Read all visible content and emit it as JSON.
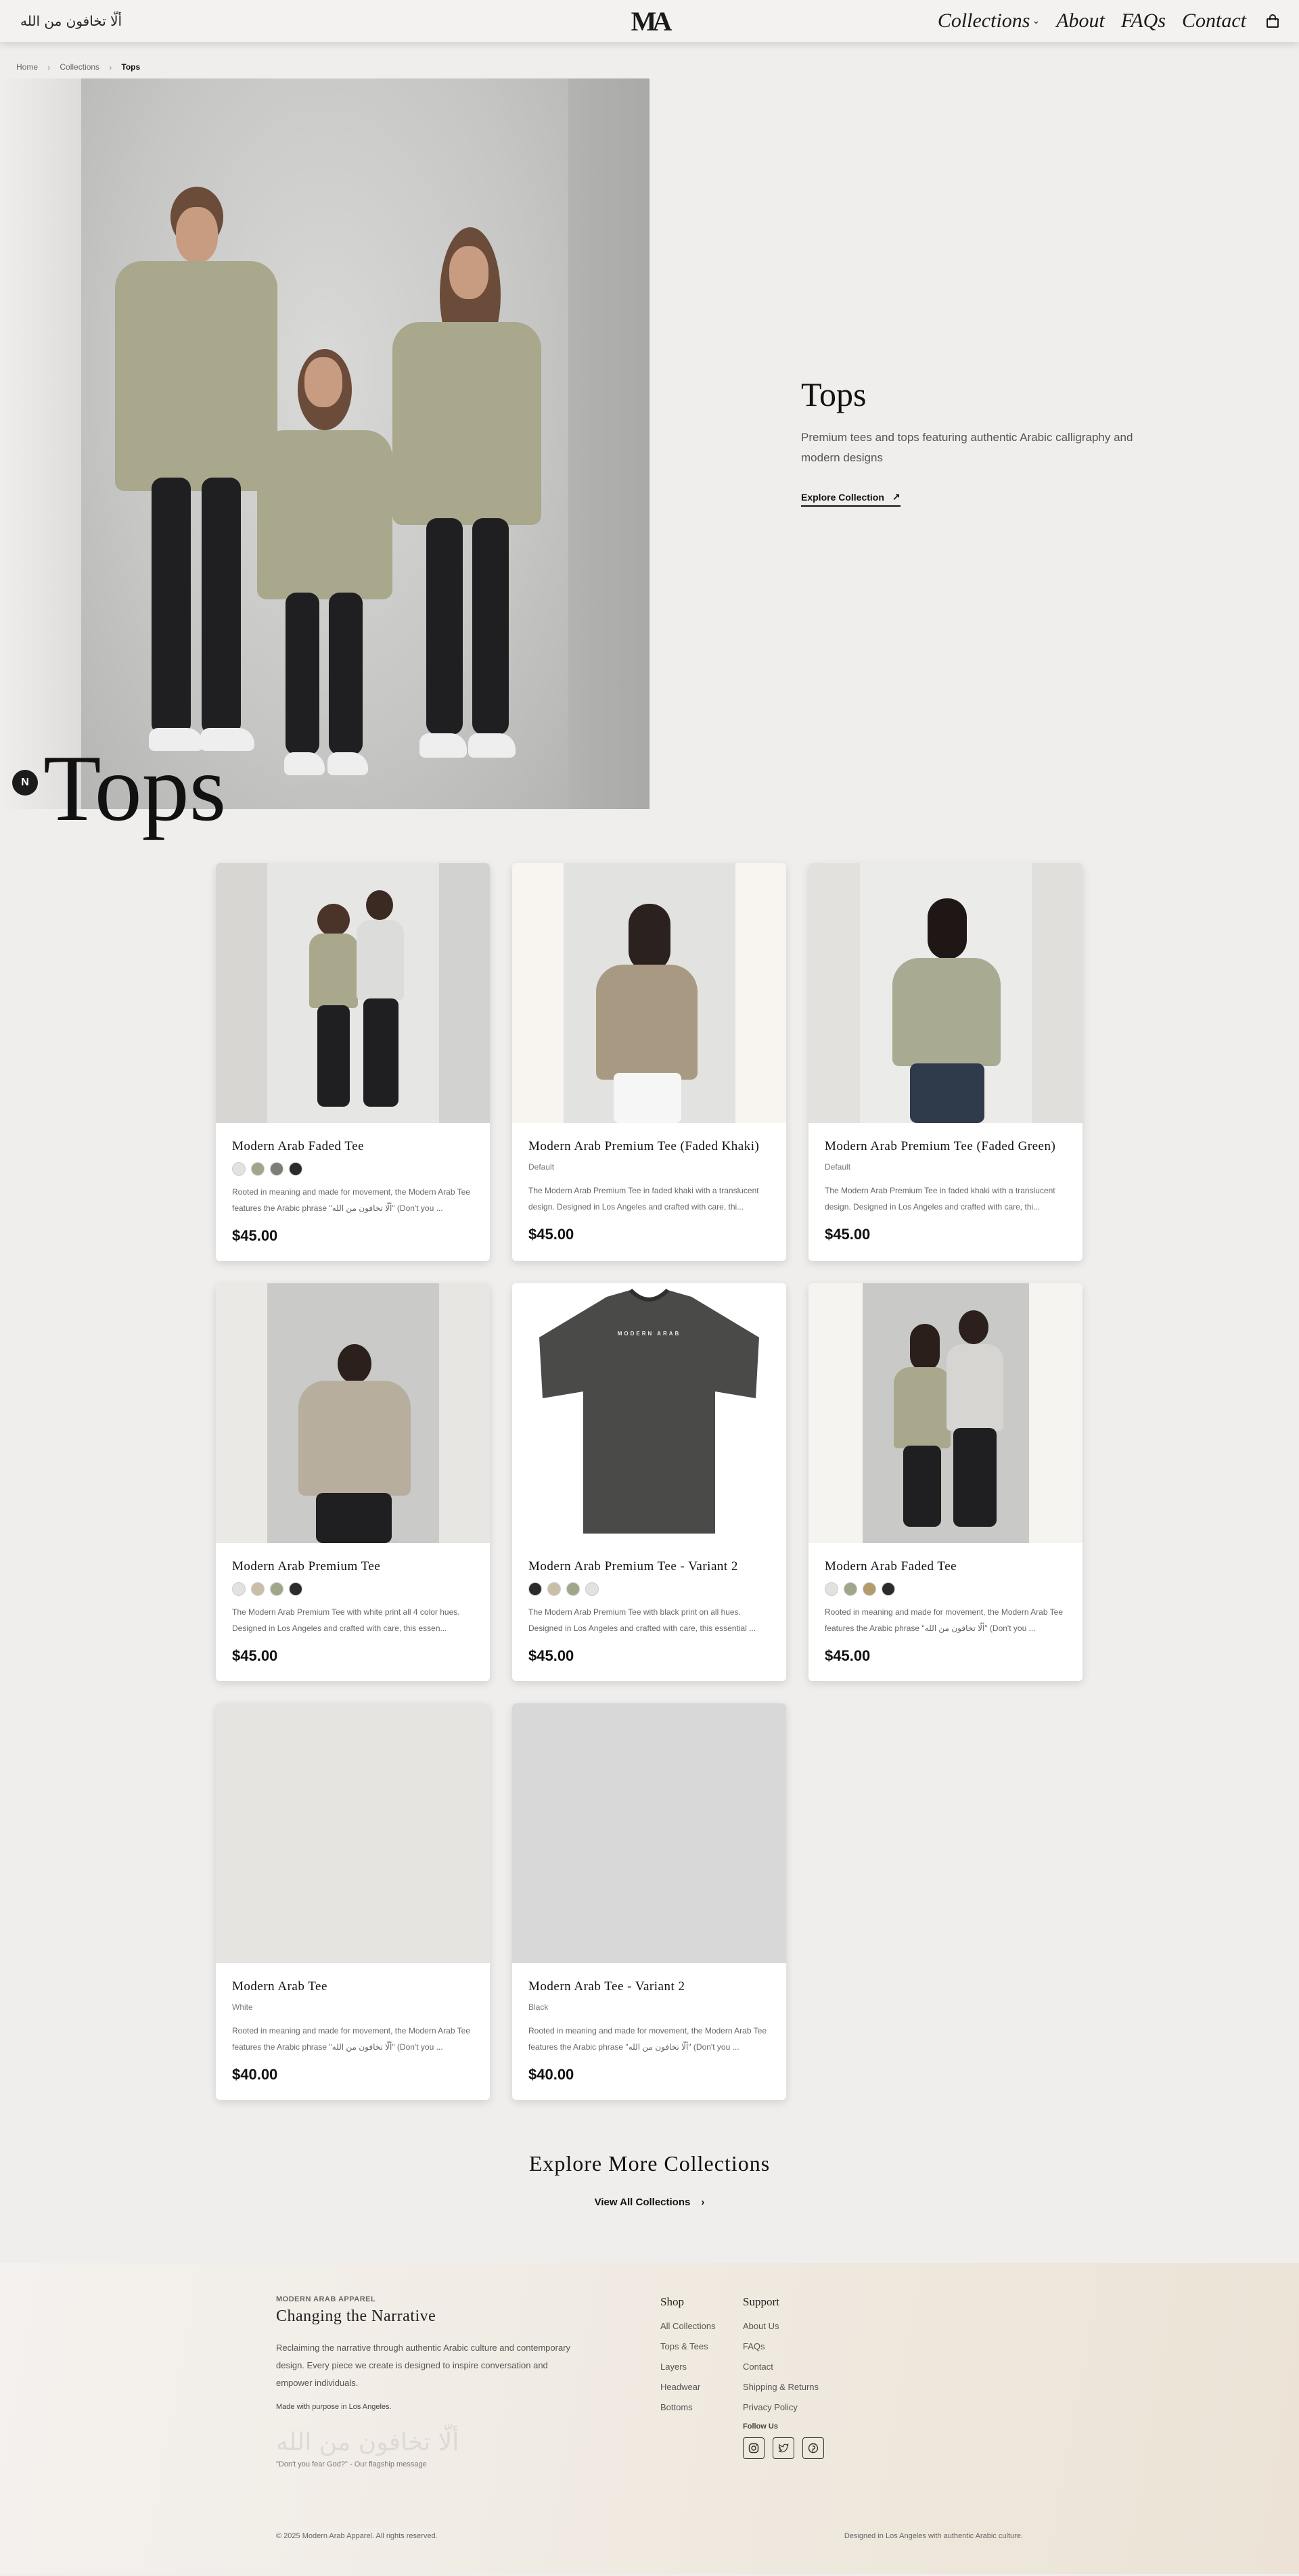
{
  "header": {
    "arabic_logo": "ألّا تخافون من الله",
    "brand_mark": "MA",
    "nav": [
      {
        "label": "Collections",
        "has_dropdown": true
      },
      {
        "label": "About"
      },
      {
        "label": "FAQs"
      },
      {
        "label": "Contact"
      }
    ],
    "cart_icon": "shopping-bag-icon"
  },
  "breadcrumb": {
    "items": [
      "Home",
      "Collections"
    ],
    "current": "Tops"
  },
  "hero": {
    "overlay_title": "Tops",
    "badge_letter": "N",
    "title": "Tops",
    "description": "Premium tees and tops featuring authentic Arabic calligraphy and modern designs",
    "cta_label": "Explore Collection",
    "cta_icon": "arrow-up-right-icon"
  },
  "products": [
    {
      "name": "Modern Arab Faded Tee",
      "swatches": [
        "#e4e2df",
        "#9fa78b",
        "#7b7e77",
        "#2b2b2b"
      ],
      "variant": "",
      "description": "Rooted in meaning and made for movement, the Modern Arab Tee features the Arabic phrase \"ألّا تخافون من الله\" (Don't you ...",
      "price": "$45.00"
    },
    {
      "name": "Modern Arab Premium Tee (Faded Khaki)",
      "swatches": [],
      "variant": "Default",
      "description": "The Modern Arab Premium Tee in faded khaki with a translucent design. Designed in Los Angeles and crafted with care, thi...",
      "price": "$45.00"
    },
    {
      "name": "Modern Arab Premium Tee (Faded Green)",
      "swatches": [],
      "variant": "Default",
      "description": "The Modern Arab Premium Tee in faded khaki with a translucent design. Designed in Los Angeles and crafted with care, thi...",
      "price": "$45.00"
    },
    {
      "name": "Modern Arab Premium Tee",
      "swatches": [
        "#e4e2df",
        "#c9bfa6",
        "#9fa78b",
        "#2b2b2b"
      ],
      "variant": "",
      "description": "The Modern Arab Premium Tee with white print all 4 color hues. Designed in Los Angeles and crafted with care, this essen...",
      "price": "$45.00"
    },
    {
      "name": "Modern Arab Premium Tee - Variant 2",
      "swatches": [
        "#2b2b2b",
        "#c9bfa6",
        "#9fa78b",
        "#e4e2df"
      ],
      "variant": "",
      "description": "The Modern Arab Premium Tee with black print on all hues. Designed in Los Angeles and crafted with care, this essential ...",
      "price": "$45.00"
    },
    {
      "name": "Modern Arab Faded Tee",
      "swatches": [
        "#e4e2df",
        "#9fa78b",
        "#b39c6a",
        "#2b2b2b"
      ],
      "variant": "",
      "description": "Rooted in meaning and made for movement, the Modern Arab Tee features the Arabic phrase \"ألّا تخافون من الله\" (Don't you ...",
      "price": "$45.00"
    },
    {
      "name": "Modern Arab Tee",
      "swatches": [],
      "variant": "White",
      "description": "Rooted in meaning and made for movement, the Modern Arab Tee features the Arabic phrase \"ألّا تخافون من الله\" (Don't you ...",
      "price": "$40.00"
    },
    {
      "name": "Modern Arab Tee - Variant 2",
      "swatches": [],
      "variant": "Black",
      "description": "Rooted in meaning and made for movement, the Modern Arab Tee features the Arabic phrase \"ألّا تخافون من الله\" (Don't you ...",
      "price": "$40.00"
    }
  ],
  "shirt_print": "MODERN ARAB",
  "explore_more": {
    "title": "Explore More Collections",
    "link_label": "View All Collections"
  },
  "footer": {
    "brand": "MODERN ARAB APPAREL",
    "tagline": "Changing the Narrative",
    "about": "Reclaiming the narrative through authentic Arabic culture and contemporary design. Every piece we create is designed to inspire conversation and empower individuals.",
    "made_with": "Made with purpose in Los Angeles.",
    "arabic_phrase": "ألّا تخافون من الله",
    "quote": "\"Don't you fear God?\" - Our flagship message",
    "shop": {
      "title": "Shop",
      "links": [
        "All Collections",
        "Tops & Tees",
        "Layers",
        "Headwear",
        "Bottoms"
      ]
    },
    "support": {
      "title": "Support",
      "links": [
        "About Us",
        "FAQs",
        "Contact",
        "Shipping & Returns",
        "Privacy Policy"
      ]
    },
    "follow_label": "Follow Us",
    "socials": [
      "instagram-icon",
      "twitter-icon",
      "pinterest-icon"
    ],
    "copyright": "© 2025 Modern Arab Apparel. All rights reserved.",
    "designed_in": "Designed in Los Angeles with authentic Arabic culture."
  }
}
